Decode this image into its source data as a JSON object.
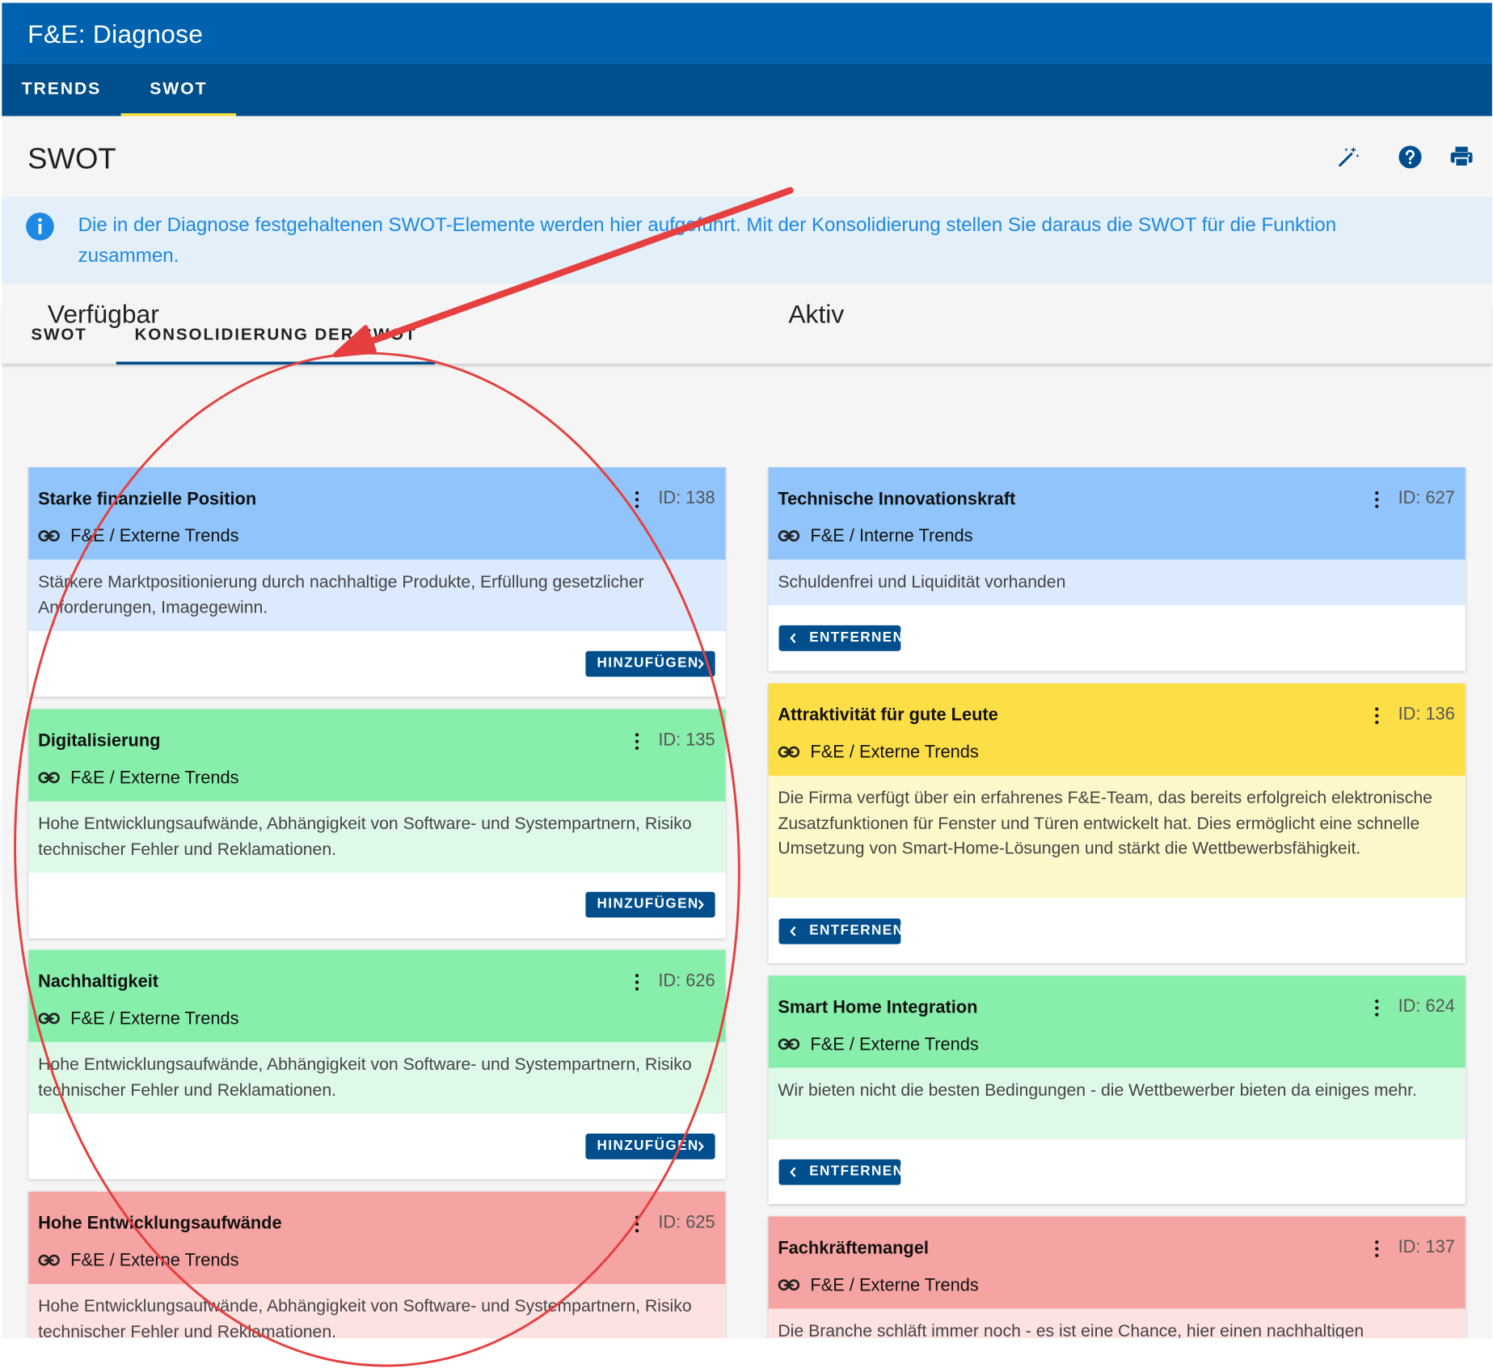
{
  "app": {
    "title": "F&E: Diagnose"
  },
  "topnav": {
    "tabs": [
      {
        "label": "TRENDS"
      },
      {
        "label": "SWOT"
      }
    ]
  },
  "page": {
    "title": "SWOT"
  },
  "toolbar": {
    "magic_icon": "magic-wand-icon",
    "help_icon": "help-icon",
    "print_icon": "print-icon"
  },
  "info": {
    "text": "Die in der Diagnose festgehaltenen SWOT-Elemente werden hier aufgeführt. Mit der Konsolidierung stellen Sie daraus die SWOT für die Funktion zusammen."
  },
  "subtabs": {
    "tabs": [
      {
        "label": "SWOT"
      },
      {
        "label": "KONSOLIDIERUNG DER SWOT"
      }
    ]
  },
  "columns": {
    "available": {
      "title": "Verfügbar",
      "button_label": "HINZUFÜGEN",
      "cards": [
        {
          "title": "Starke finanzielle Position",
          "id": "ID: 138",
          "source": "F&E / Externe Trends",
          "text": "Stärkere Marktpositionierung durch nachhaltige Produkte, Erfüllung gesetzlicher Anforderungen, Imagegewinn.",
          "color": "blue"
        },
        {
          "title": "Digitalisierung",
          "id": "ID: 135",
          "source": "F&E / Externe Trends",
          "text": "Hohe Entwicklungsaufwände, Abhängigkeit von Software- und Systempartnern, Risiko technischer Fehler und Reklamationen.",
          "color": "green"
        },
        {
          "title": "Nachhaltigkeit",
          "id": "ID: 626",
          "source": "F&E / Externe Trends",
          "text": "Hohe Entwicklungsaufwände, Abhängigkeit von Software- und Systempartnern, Risiko technischer Fehler und Reklamationen.",
          "color": "green"
        },
        {
          "title": "Hohe Entwicklungsaufwände",
          "id": "ID: 625",
          "source": "F&E / Externe Trends",
          "text": "Hohe Entwicklungsaufwände, Abhängigkeit von Software- und Systempartnern, Risiko technischer Fehler und Reklamationen.",
          "color": "red"
        }
      ]
    },
    "active": {
      "title": "Aktiv",
      "button_label": "ENTFERNEN",
      "cards": [
        {
          "title": "Technische Innovationskraft",
          "id": "ID: 627",
          "source": "F&E / Interne Trends",
          "text": "Schuldenfrei und Liquidität vorhanden",
          "color": "blue"
        },
        {
          "title": "Attraktivität für gute Leute",
          "id": "ID: 136",
          "source": "F&E / Externe Trends",
          "text": "Die Firma verfügt über ein erfahrenes F&E-Team, das bereits erfolgreich elektronische Zusatzfunktionen für Fenster und Türen entwickelt hat. Dies ermöglicht eine schnelle Umsetzung von Smart-Home-Lösungen und stärkt die Wettbewerbsfähigkeit.",
          "color": "yellow"
        },
        {
          "title": "Smart Home Integration",
          "id": "ID: 624",
          "source": "F&E / Externe Trends",
          "text": "Wir bieten nicht die besten Bedingungen - die Wettbewerber bieten da einiges mehr.",
          "color": "green"
        },
        {
          "title": "Fachkräftemangel",
          "id": "ID: 137",
          "source": "F&E / Externe Trends",
          "text": "Die Branche schläft immer noch - es ist eine Chance, hier einen nachhaltigen",
          "color": "red"
        }
      ]
    }
  },
  "annotation": {
    "color": "#e5403f"
  }
}
